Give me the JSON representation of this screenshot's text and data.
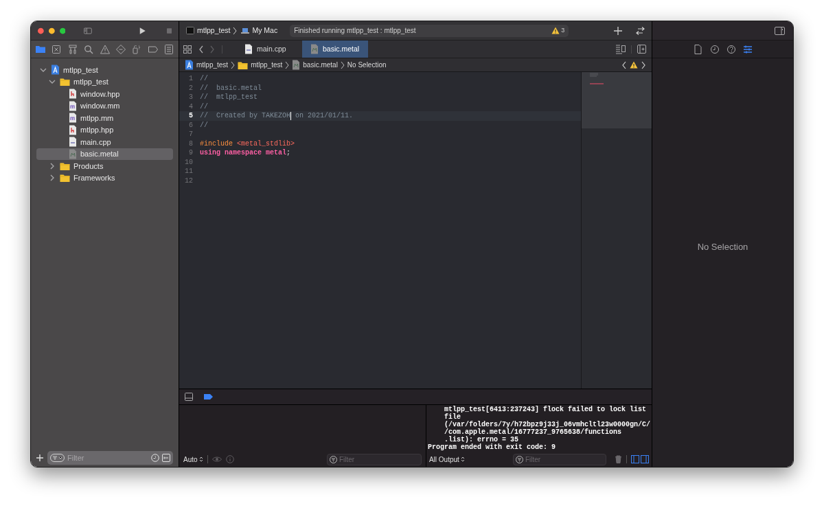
{
  "toolbar": {
    "scheme": "mtlpp_test",
    "destination": "My Mac",
    "activity": "Finished running mtlpp_test : mtlpp_test",
    "warning_count": "3"
  },
  "navigator": {
    "tabs": [
      {
        "selected": true
      },
      {
        "selected": false
      },
      {
        "selected": false
      },
      {
        "selected": false
      },
      {
        "selected": false
      },
      {
        "selected": false
      },
      {
        "selected": false
      },
      {
        "selected": false
      },
      {
        "selected": false
      }
    ],
    "tree": [
      {
        "label": "mtlpp_test",
        "kind": "project",
        "expanded": true,
        "selected": false,
        "children": [
          {
            "label": "mtlpp_test",
            "kind": "folder",
            "expanded": true,
            "selected": false,
            "children": [
              {
                "label": "window.hpp",
                "kind": "header",
                "selected": false
              },
              {
                "label": "window.mm",
                "kind": "objc",
                "selected": false
              },
              {
                "label": "mtlpp.mm",
                "kind": "objc",
                "selected": false
              },
              {
                "label": "mtlpp.hpp",
                "kind": "header",
                "selected": false
              },
              {
                "label": "main.cpp",
                "kind": "cpp",
                "selected": false
              },
              {
                "label": "basic.metal",
                "kind": "metal",
                "selected": true
              }
            ]
          },
          {
            "label": "Products",
            "kind": "folder",
            "expanded": false,
            "selected": false
          },
          {
            "label": "Frameworks",
            "kind": "folder",
            "expanded": false,
            "selected": false
          }
        ]
      }
    ],
    "filter_placeholder": "Filter"
  },
  "editor": {
    "tabs": [
      {
        "label": "main.cpp",
        "kind": "cpp",
        "selected": false
      },
      {
        "label": "basic.metal",
        "kind": "metal",
        "selected": true
      }
    ],
    "breadcrumb": [
      {
        "label": "mtlpp_test",
        "kind": "project"
      },
      {
        "label": "mtlpp_test",
        "kind": "folder"
      },
      {
        "label": "basic.metal",
        "kind": "metal"
      },
      {
        "label": "No Selection",
        "kind": "text"
      }
    ],
    "lines": [
      {
        "number": "1",
        "tokens": [
          {
            "text": "//",
            "kind": "comment"
          }
        ]
      },
      {
        "number": "2",
        "tokens": [
          {
            "text": "//  basic.metal",
            "kind": "comment"
          }
        ]
      },
      {
        "number": "3",
        "tokens": [
          {
            "text": "//  mtlpp_test",
            "kind": "comment"
          }
        ]
      },
      {
        "number": "4",
        "tokens": [
          {
            "text": "//",
            "kind": "comment"
          }
        ]
      },
      {
        "number": "5",
        "current": true,
        "tokens": [
          {
            "text": "//  Created by TAKEZOH",
            "kind": "comment",
            "cursor": true
          },
          {
            "text": " on 2021/01/11.",
            "kind": "comment"
          }
        ]
      },
      {
        "number": "6",
        "tokens": [
          {
            "text": "//",
            "kind": "comment"
          }
        ]
      },
      {
        "number": "7"
      },
      {
        "number": "8",
        "tokens": [
          {
            "text": "#include",
            "kind": "preprocessor"
          },
          {
            "text": " <metal_stdlib>",
            "kind": "string"
          }
        ]
      },
      {
        "number": "9",
        "tokens": [
          {
            "text": "using",
            "kind": "keyword"
          },
          {
            "text": " namespace",
            "kind": "keyword"
          },
          {
            "text": " metal",
            "kind": "keyword"
          },
          {
            "text": ";",
            "kind": "plain"
          }
        ]
      },
      {
        "number": "10"
      },
      {
        "number": "11"
      },
      {
        "number": "12"
      }
    ]
  },
  "debug": {
    "scope": "Auto",
    "variables_filter_placeholder": "Filter",
    "console": [
      {
        "text": "mtlpp_test[6413:237243] flock failed to lock list",
        "indent": true
      },
      {
        "text": "file",
        "indent": true
      },
      {
        "text": "(/var/folders/7y/h72bpz9j33j_06vmhcltl23w0000gn/C/",
        "indent": true
      },
      {
        "text": "/com.apple.metal/16777237_9765638/functions",
        "indent": true
      },
      {
        "text": ".list): errno = 35",
        "indent": true
      },
      {
        "text": "Program ended with exit code: 9",
        "indent": false
      }
    ],
    "output": "All Output",
    "console_filter_placeholder": "Filter"
  },
  "inspector": {
    "tabs": [
      {
        "selected": false
      },
      {
        "selected": false
      },
      {
        "selected": false
      },
      {
        "selected": true
      }
    ],
    "empty": "No Selection"
  }
}
